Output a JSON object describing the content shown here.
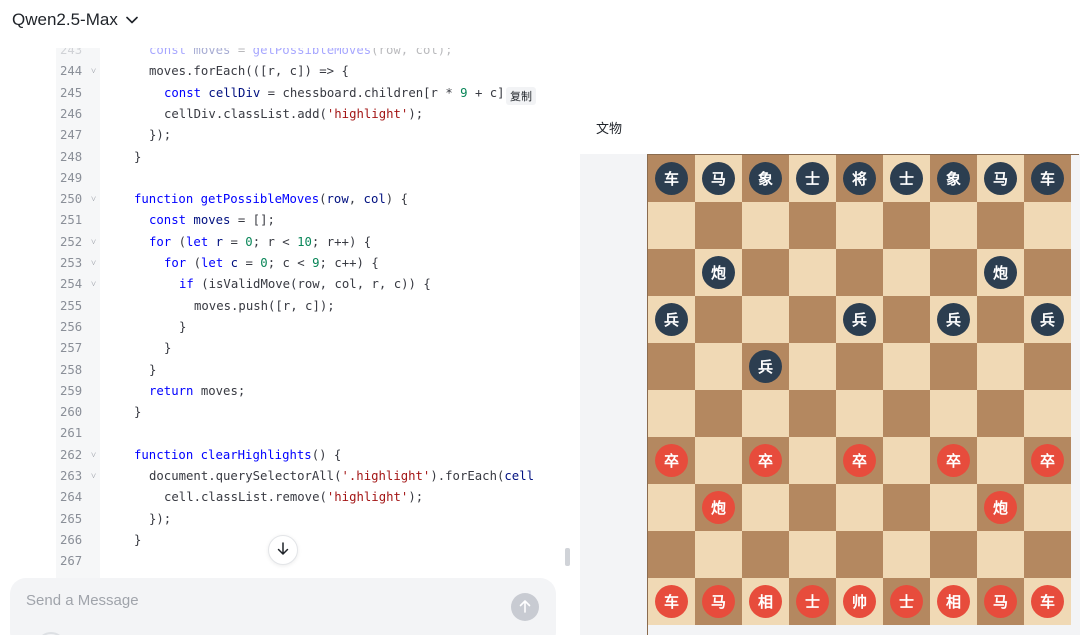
{
  "header": {
    "model_name": "Qwen2.5-Max"
  },
  "code": {
    "lines": [
      {
        "n": "243",
        "fold": false,
        "faded": true,
        "indent": 1,
        "tokens": [
          [
            "kw",
            "const "
          ],
          [
            "var",
            "moves"
          ],
          [
            "pr",
            " = "
          ],
          [
            "fn",
            "getPossibleMoves"
          ],
          [
            "pr",
            "(row, col);"
          ]
        ]
      },
      {
        "n": "244",
        "fold": true,
        "indent": 1,
        "tokens": [
          [
            "pr",
            "moves.forEach(([r, c]) => {"
          ]
        ]
      },
      {
        "n": "245",
        "fold": false,
        "indent": 2,
        "tokens": [
          [
            "kw",
            "const "
          ],
          [
            "var",
            "cellDiv"
          ],
          [
            "pr",
            " = chessboard.children[r * "
          ],
          [
            "num",
            "9"
          ],
          [
            "pr",
            " + c];"
          ]
        ]
      },
      {
        "n": "246",
        "fold": false,
        "indent": 2,
        "tokens": [
          [
            "pr",
            "cellDiv.classList.add("
          ],
          [
            "str",
            "'highlight'"
          ],
          [
            "pr",
            ");"
          ]
        ]
      },
      {
        "n": "247",
        "fold": false,
        "indent": 1,
        "tokens": [
          [
            "pr",
            "});"
          ]
        ]
      },
      {
        "n": "248",
        "fold": false,
        "indent": 0,
        "tokens": [
          [
            "pr",
            "}"
          ]
        ]
      },
      {
        "n": "249",
        "fold": false,
        "indent": 0,
        "tokens": []
      },
      {
        "n": "250",
        "fold": true,
        "indent": 0,
        "tokens": [
          [
            "kw",
            "function "
          ],
          [
            "fn",
            "getPossibleMoves"
          ],
          [
            "pr",
            "("
          ],
          [
            "var",
            "row"
          ],
          [
            "pr",
            ", "
          ],
          [
            "var",
            "col"
          ],
          [
            "pr",
            ") {"
          ]
        ]
      },
      {
        "n": "251",
        "fold": false,
        "indent": 1,
        "tokens": [
          [
            "kw",
            "const "
          ],
          [
            "var",
            "moves"
          ],
          [
            "pr",
            " = [];"
          ]
        ]
      },
      {
        "n": "252",
        "fold": true,
        "indent": 1,
        "tokens": [
          [
            "kw",
            "for "
          ],
          [
            "pr",
            "("
          ],
          [
            "kw",
            "let "
          ],
          [
            "var",
            "r"
          ],
          [
            "pr",
            " = "
          ],
          [
            "num",
            "0"
          ],
          [
            "pr",
            "; r < "
          ],
          [
            "num",
            "10"
          ],
          [
            "pr",
            "; r++) {"
          ]
        ]
      },
      {
        "n": "253",
        "fold": true,
        "indent": 2,
        "tokens": [
          [
            "kw",
            "for "
          ],
          [
            "pr",
            "("
          ],
          [
            "kw",
            "let "
          ],
          [
            "var",
            "c"
          ],
          [
            "pr",
            " = "
          ],
          [
            "num",
            "0"
          ],
          [
            "pr",
            "; c < "
          ],
          [
            "num",
            "9"
          ],
          [
            "pr",
            "; c++) {"
          ]
        ]
      },
      {
        "n": "254",
        "fold": true,
        "indent": 3,
        "tokens": [
          [
            "kw",
            "if "
          ],
          [
            "pr",
            "(isValidMove(row, col, r, c)) {"
          ]
        ]
      },
      {
        "n": "255",
        "fold": false,
        "indent": 4,
        "tokens": [
          [
            "pr",
            "moves.push([r, c]);"
          ]
        ]
      },
      {
        "n": "256",
        "fold": false,
        "indent": 3,
        "tokens": [
          [
            "pr",
            "}"
          ]
        ]
      },
      {
        "n": "257",
        "fold": false,
        "indent": 2,
        "tokens": [
          [
            "pr",
            "}"
          ]
        ]
      },
      {
        "n": "258",
        "fold": false,
        "indent": 1,
        "tokens": [
          [
            "pr",
            "}"
          ]
        ]
      },
      {
        "n": "259",
        "fold": false,
        "indent": 1,
        "tokens": [
          [
            "kw",
            "return "
          ],
          [
            "pr",
            "moves;"
          ]
        ]
      },
      {
        "n": "260",
        "fold": false,
        "indent": 0,
        "tokens": [
          [
            "pr",
            "}"
          ]
        ]
      },
      {
        "n": "261",
        "fold": false,
        "indent": 0,
        "tokens": []
      },
      {
        "n": "262",
        "fold": true,
        "indent": 0,
        "tokens": [
          [
            "kw",
            "function "
          ],
          [
            "fn",
            "clearHighlights"
          ],
          [
            "pr",
            "() {"
          ]
        ]
      },
      {
        "n": "263",
        "fold": true,
        "indent": 1,
        "tokens": [
          [
            "pr",
            "document.querySelectorAll("
          ],
          [
            "str",
            "'.highlight'"
          ],
          [
            "pr",
            ").forEach("
          ],
          [
            "var",
            "cell"
          ]
        ]
      },
      {
        "n": "264",
        "fold": false,
        "indent": 2,
        "tokens": [
          [
            "pr",
            "cell.classList.remove("
          ],
          [
            "str",
            "'highlight'"
          ],
          [
            "pr",
            ");"
          ]
        ]
      },
      {
        "n": "265",
        "fold": false,
        "indent": 1,
        "tokens": [
          [
            "pr",
            "});"
          ]
        ]
      },
      {
        "n": "266",
        "fold": false,
        "indent": 0,
        "tokens": [
          [
            "pr",
            "}"
          ]
        ]
      },
      {
        "n": "267",
        "fold": false,
        "indent": 0,
        "tokens": []
      }
    ]
  },
  "copy_tooltip": "复制",
  "message": {
    "placeholder": "Send a Message"
  },
  "preview": {
    "label": "文物",
    "rows": 10,
    "cols": 9,
    "colors": {
      "dark": "#b48860",
      "light": "#f0d9b5",
      "black_piece": "#2c3e50",
      "red_piece": "#e74c3c"
    },
    "pieces": [
      {
        "r": 0,
        "c": 0,
        "t": "车",
        "side": "black"
      },
      {
        "r": 0,
        "c": 1,
        "t": "马",
        "side": "black"
      },
      {
        "r": 0,
        "c": 2,
        "t": "象",
        "side": "black"
      },
      {
        "r": 0,
        "c": 3,
        "t": "士",
        "side": "black"
      },
      {
        "r": 0,
        "c": 4,
        "t": "将",
        "side": "black"
      },
      {
        "r": 0,
        "c": 5,
        "t": "士",
        "side": "black"
      },
      {
        "r": 0,
        "c": 6,
        "t": "象",
        "side": "black"
      },
      {
        "r": 0,
        "c": 7,
        "t": "马",
        "side": "black"
      },
      {
        "r": 0,
        "c": 8,
        "t": "车",
        "side": "black"
      },
      {
        "r": 2,
        "c": 1,
        "t": "炮",
        "side": "black"
      },
      {
        "r": 2,
        "c": 7,
        "t": "炮",
        "side": "black"
      },
      {
        "r": 3,
        "c": 0,
        "t": "兵",
        "side": "black"
      },
      {
        "r": 3,
        "c": 4,
        "t": "兵",
        "side": "black"
      },
      {
        "r": 3,
        "c": 6,
        "t": "兵",
        "side": "black"
      },
      {
        "r": 3,
        "c": 8,
        "t": "兵",
        "side": "black"
      },
      {
        "r": 4,
        "c": 2,
        "t": "兵",
        "side": "black"
      },
      {
        "r": 6,
        "c": 0,
        "t": "卒",
        "side": "red"
      },
      {
        "r": 6,
        "c": 2,
        "t": "卒",
        "side": "red"
      },
      {
        "r": 6,
        "c": 4,
        "t": "卒",
        "side": "red"
      },
      {
        "r": 6,
        "c": 6,
        "t": "卒",
        "side": "red"
      },
      {
        "r": 6,
        "c": 8,
        "t": "卒",
        "side": "red"
      },
      {
        "r": 7,
        "c": 1,
        "t": "炮",
        "side": "red"
      },
      {
        "r": 7,
        "c": 7,
        "t": "炮",
        "side": "red"
      },
      {
        "r": 9,
        "c": 0,
        "t": "车",
        "side": "red"
      },
      {
        "r": 9,
        "c": 1,
        "t": "马",
        "side": "red"
      },
      {
        "r": 9,
        "c": 2,
        "t": "相",
        "side": "red"
      },
      {
        "r": 9,
        "c": 3,
        "t": "士",
        "side": "red"
      },
      {
        "r": 9,
        "c": 4,
        "t": "帅",
        "side": "red"
      },
      {
        "r": 9,
        "c": 5,
        "t": "士",
        "side": "red"
      },
      {
        "r": 9,
        "c": 6,
        "t": "相",
        "side": "red"
      },
      {
        "r": 9,
        "c": 7,
        "t": "马",
        "side": "red"
      },
      {
        "r": 9,
        "c": 8,
        "t": "车",
        "side": "red"
      }
    ]
  }
}
